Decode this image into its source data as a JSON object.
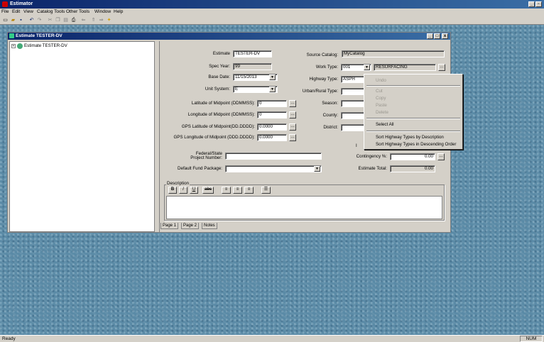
{
  "window": {
    "title": "Estimator"
  },
  "menu": [
    "File",
    "Edit",
    "View",
    "Catalog Tools",
    "Other Tools",
    "Window",
    "Help"
  ],
  "toolbar_icons": [
    "new-icon",
    "open-icon",
    "save-icon",
    "undo-icon",
    "redo-icon",
    "cut-icon",
    "copy-icon",
    "paste-icon",
    "print-icon",
    "back-icon",
    "up-icon",
    "forward-icon",
    "wizard-icon"
  ],
  "child": {
    "title": "Estimate TESTER-DV",
    "tree_root": "Estimate TESTER-DV"
  },
  "form": {
    "estimate_label": "Estimate",
    "estimate_value": "TESTER-DV",
    "spec_year_label": "Spec Year:",
    "spec_year_value": "99",
    "base_date_label": "Base Date:",
    "base_date_value": "11/15/2013",
    "unit_system_label": "Unit System:",
    "unit_system_value": "E",
    "lat_label": "Latitude of Midpoint (DDMMSS):",
    "lat_value": "0",
    "lon_label": "Longitude of Midpoint (DDMMSS):",
    "lon_value": "0",
    "gps_lat_label": "GPS Latitude of Midpoint(DD.DDDD):",
    "gps_lat_value": "0.0000",
    "gps_lon_label": "GPS Longitude of Midpoint (DDD.DDDD):",
    "gps_lon_value": "0.0000",
    "federal_label_1": "Federal/State",
    "federal_label_2": "Project Number:",
    "default_fund_label": "Default Fund Package:",
    "source_catalog_label": "Source Catalog:",
    "source_catalog_value": "MyCatalog",
    "work_type_label": "Work Type:",
    "work_type_code": "001",
    "work_type_value": "RESURFACING",
    "highway_type_label": "Highway Type:",
    "highway_type_value": "ASPH",
    "urban_rural_label": "Urban/Rural Type:",
    "season_label": "Season:",
    "county_label": "County:",
    "district_label": "District:",
    "contingency_label": "Contingency %:",
    "contingency_value": "0.00",
    "estimate_total_label": "Estimate Total:",
    "estimate_total_value": "0.00",
    "description_label": "Description",
    "format_buttons": [
      "B",
      "I",
      "U",
      "abc"
    ]
  },
  "tabs": [
    "Page 1",
    "Page 2",
    "Notes"
  ],
  "context_menu": {
    "undo": "Undo",
    "cut": "Cut",
    "copy": "Copy",
    "paste": "Paste",
    "delete": "Delete",
    "select_all": "Select All",
    "sort_desc": "Sort Highway Types by Description",
    "sort_desc_order": "Sort Highway Types in Descending Order"
  },
  "status": {
    "left": "Ready",
    "num": "NUM"
  }
}
